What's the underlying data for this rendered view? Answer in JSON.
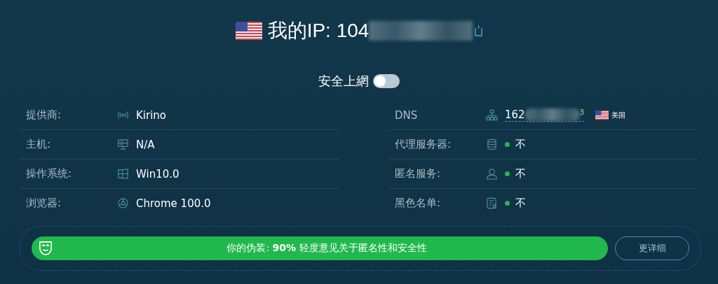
{
  "header": {
    "label": "我的IP:",
    "ip_visible": "104",
    "redacted": true
  },
  "secure_browsing": {
    "label": "安全上網",
    "on": false
  },
  "left_rows": [
    {
      "label": "提供商:",
      "value": "Kirino"
    },
    {
      "label": "主机:",
      "value": "N/A"
    },
    {
      "label": "操作系统:",
      "value": "Win10.0"
    },
    {
      "label": "浏览器:",
      "value": "Chrome 100.0"
    }
  ],
  "right_rows": [
    {
      "label": "DNS",
      "kind": "dns",
      "value": "162",
      "redacted": true,
      "count": "3",
      "country": "美国"
    },
    {
      "label": "代理服务器:",
      "kind": "status",
      "ok": true,
      "value": "不"
    },
    {
      "label": "匿名服务:",
      "kind": "status",
      "ok": true,
      "value": "不"
    },
    {
      "label": "黑色名单:",
      "kind": "status",
      "ok": true,
      "value": "不"
    }
  ],
  "disguise": {
    "text": "你的伪装: **90%** 轻度意见关于匿名性和安全性",
    "button": "更详细"
  }
}
